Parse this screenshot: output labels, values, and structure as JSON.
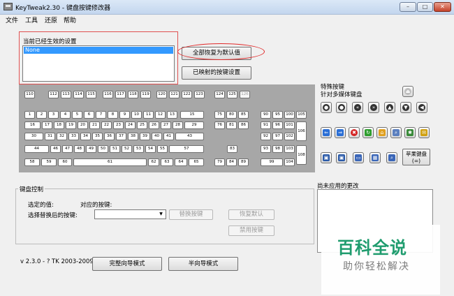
{
  "window": {
    "title": "KeyTweak2.30 -   键盘按键修改器",
    "min_glyph": "–",
    "max_glyph": "□",
    "close_glyph": "✕"
  },
  "menu": [
    "文件",
    "工具",
    "还原",
    "帮助"
  ],
  "active_settings": {
    "label": "当前已经生效的设置",
    "items": [
      "None"
    ]
  },
  "buttons": {
    "restore_defaults": "全部恢复为默认值",
    "mapped_keys": "已映射的按键设置",
    "replace_key": "替换按键",
    "restore_default": "恢复默认",
    "disable_key": "禁用按键",
    "full_wizard": "完整向导模式",
    "half_wizard": "半向导模式"
  },
  "keyboard": {
    "row_f": [
      "110",
      "112",
      "113",
      "114",
      "115",
      "116",
      "117",
      "118",
      "119",
      "120",
      "121",
      "122",
      "123",
      "124",
      "125",
      "126"
    ],
    "row_1": [
      "1",
      "2",
      "3",
      "4",
      "5",
      "6",
      "7",
      "8",
      "9",
      "10",
      "11",
      "12",
      "13",
      "15"
    ],
    "row_2": [
      "16",
      "17",
      "18",
      "19",
      "20",
      "21",
      "22",
      "23",
      "24",
      "25",
      "26",
      "27",
      "28",
      "29"
    ],
    "row_3": [
      "30",
      "31",
      "32",
      "33",
      "34",
      "35",
      "36",
      "37",
      "38",
      "39",
      "40",
      "41",
      "43"
    ],
    "row_4": [
      "44",
      "46",
      "47",
      "48",
      "49",
      "50",
      "51",
      "52",
      "53",
      "54",
      "55",
      "57"
    ],
    "row_5": [
      "58",
      "59",
      "60",
      "61",
      "62",
      "63",
      "64",
      "65"
    ],
    "nav": [
      "75",
      "80",
      "85",
      "76",
      "81",
      "86",
      "83",
      "79",
      "84",
      "89"
    ],
    "numpad": [
      "90",
      "95",
      "100",
      "105",
      "91",
      "96",
      "101",
      "106",
      "92",
      "97",
      "102",
      "93",
      "98",
      "103",
      "108",
      "99",
      "104"
    ]
  },
  "special": {
    "title": "特殊按键",
    "subtitle": "针对多媒体键盘",
    "apple_label": "苹果键盘",
    "apple_sub": "(=)"
  },
  "key_control": {
    "title": "键盘控制",
    "selected_label": "选定的值:",
    "mapped_label": "对应的按键:",
    "replace_label": "选择替换后的按键:"
  },
  "pending": {
    "title": "尚未应用的更改"
  },
  "version": "v 2.3.0 - ? TK 2003-2009",
  "watermark": {
    "main": "百科全说",
    "sub": "助你轻松解决"
  }
}
